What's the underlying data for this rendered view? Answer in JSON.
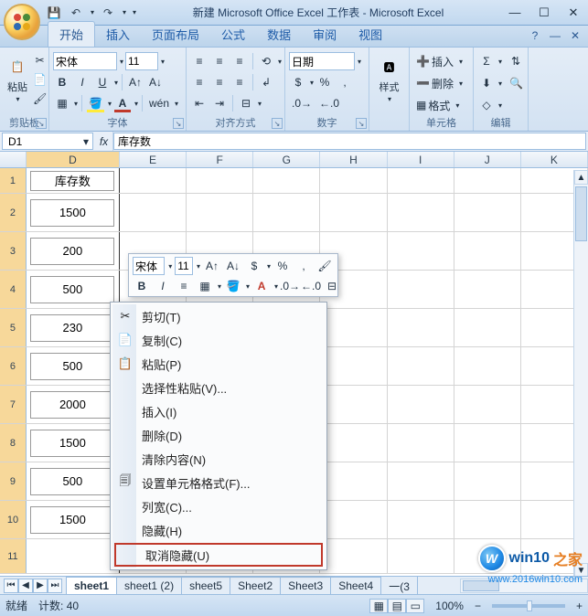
{
  "titlebar": {
    "title": "新建 Microsoft Office Excel 工作表 - Microsoft Excel",
    "qat": {
      "save": "💾",
      "undo": "↶",
      "redo": "↷"
    }
  },
  "tabs": {
    "home": "开始",
    "insert": "插入",
    "layout": "页面布局",
    "formulas": "公式",
    "data": "数据",
    "review": "审阅",
    "view": "视图"
  },
  "ribbon": {
    "clipboard": {
      "label": "剪贴板",
      "paste": "粘贴"
    },
    "font": {
      "label": "字体",
      "name": "宋体",
      "size": "11"
    },
    "align": {
      "label": "对齐方式"
    },
    "number": {
      "label": "数字",
      "format": "日期"
    },
    "styles": {
      "label": "样式",
      "btn": "样式"
    },
    "cells": {
      "label": "单元格",
      "insert": "插入",
      "delete": "删除",
      "format": "格式"
    },
    "editing": {
      "label": "编辑"
    }
  },
  "namebox": "D1",
  "formula": "库存数",
  "columns": [
    "D",
    "E",
    "F",
    "G",
    "H",
    "I",
    "J",
    "K"
  ],
  "rows": {
    "1": "库存数",
    "2": "1500",
    "3": "200",
    "4": "500",
    "5": "230",
    "6": "500",
    "7": "2000",
    "8": "1500",
    "9": "500",
    "10": "1500",
    "11": ""
  },
  "minibar": {
    "font": "宋体",
    "size": "11"
  },
  "ctx": {
    "cut": "剪切(T)",
    "copy": "复制(C)",
    "paste": "粘贴(P)",
    "pastespecial": "选择性粘贴(V)...",
    "insert": "插入(I)",
    "delete": "删除(D)",
    "clear": "清除内容(N)",
    "formatcells": "设置单元格格式(F)...",
    "colwidth": "列宽(C)...",
    "hide": "隐藏(H)",
    "unhide": "取消隐藏(U)"
  },
  "sheets": [
    "sheet1",
    "sheet1 (2)",
    "sheet5",
    "Sheet2",
    "Sheet3",
    "Sheet4",
    "一(3"
  ],
  "status": {
    "ready": "就绪",
    "count_label": "计数:",
    "count": "40",
    "zoom": "100%"
  },
  "watermark": {
    "t1": "win10",
    "t2": "之家",
    "url": "www.2016win10.com"
  }
}
